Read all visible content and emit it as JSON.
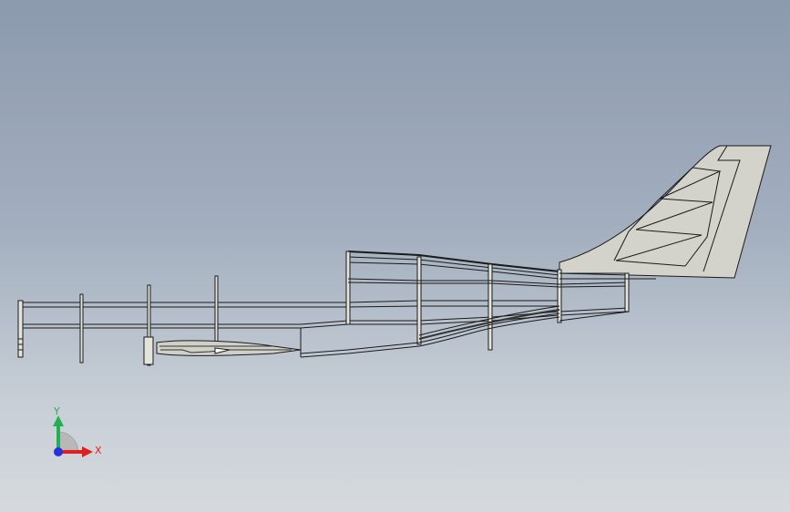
{
  "viewport": {
    "background_top": "#8c9aae",
    "background_bottom": "#d6dade"
  },
  "triad": {
    "x_label": "X",
    "y_label": "Y",
    "x_color": "#e02020",
    "y_color": "#22b14c",
    "z_color": "#2233dd"
  },
  "model": {
    "frame_color": "#e4e4dc",
    "outline_color": "#1a1a1a",
    "tail_fill": "#d3d3cb"
  }
}
